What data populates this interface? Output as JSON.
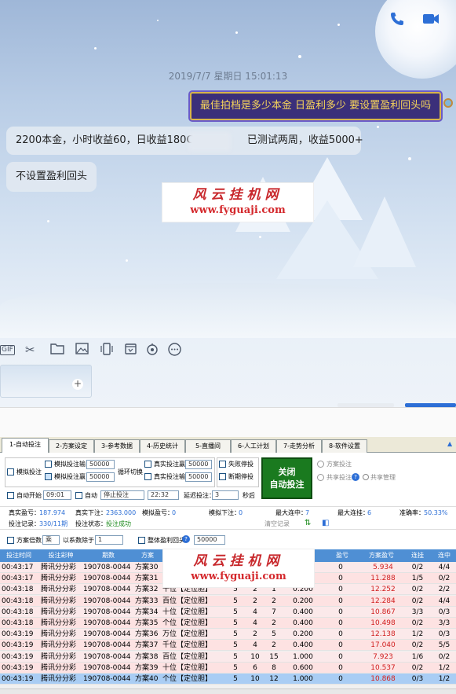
{
  "chat": {
    "timestamp": "2019/7/7 星期日 15:01:13",
    "my_message": "最佳拍档是多少本金 日盈利多少 要设置盈利回头吗",
    "reply1_a": "2200本金，小时收益60，日收益180C",
    "reply1_b": "已测试两周，收益5000+",
    "reply2": "不设置盈利回头",
    "watermark_cn": "风云挂机网",
    "watermark_url": "www.fyguaji.com",
    "toolbar_icons": [
      "gif-icon",
      "scissors-icon",
      "folder-icon",
      "image-icon",
      "shake-icon",
      "calendar-icon",
      "voice-icon",
      "more-icon"
    ],
    "gif_label": "GIF"
  },
  "app": {
    "tabs": [
      "1-自动投注",
      "2-方案设定",
      "3-参考数据",
      "4-历史统计",
      "5-直播间",
      "6-人工计划",
      "7-走势分析",
      "8-软件设置"
    ],
    "controls": {
      "sim_bet": "模拟投注",
      "sim_lose": "模拟投注输",
      "sim_win": "模拟投注赢",
      "real_win": "真实投注赢",
      "real_lose": "真实投注输",
      "val_50000": "50000",
      "loop_switch": "循环切换",
      "stop_fail": "失败停投",
      "stop_break": "断期停投",
      "close_auto": "关闭",
      "close_auto2": "自动投注",
      "plan_bet": "方案投注",
      "share_bet": "共享投注",
      "share_mgr": "共享管理",
      "auto_start": "自动开始",
      "start_time": "09:01",
      "auto": "自动",
      "stop_select": "停止投注",
      "end_time": "22:32",
      "delay": "延迟投注：",
      "delay_val": "3",
      "seconds": "秒后"
    },
    "stats": {
      "real_pl_label": "真实盈亏：",
      "real_pl": "187.974",
      "real_bet_label": "真实下注：",
      "real_bet": "2363.000",
      "sim_pl_label": "模拟盈亏：",
      "sim_pl": "0",
      "sim_bet_label": "模拟下注：",
      "sim_bet": "0",
      "max_win_label": "最大连中：",
      "max_win": "7",
      "max_lose_label": "最大连挂：",
      "max_lose": "6",
      "accuracy_label": "准确率：",
      "accuracy": "50.33%",
      "record_label": "投注记录：",
      "record": "330/11期",
      "status_label": "投注状态：",
      "status": "投注成功",
      "clear_log": "清空记录"
    },
    "options": {
      "plan_mult": "方案倍数",
      "mult_val": "乘",
      "factor": "以系数除于：",
      "factor_val": "1",
      "overall_back": "整体盈利回头",
      "overall_val": "50000"
    },
    "grid": {
      "headers": [
        "投注时间",
        "投注彩种",
        "期数",
        "方案",
        "",
        "",
        "",
        "",
        "盈亏",
        "方案盈亏",
        "连挂",
        "连中"
      ],
      "rows": [
        {
          "time": "00:43:17",
          "game": "腾讯分分彩",
          "issue": "190708-0044",
          "plan": "方案30",
          "pos": "",
          "a": "",
          "b": "",
          "c": "",
          "amt": "",
          "pl": "0",
          "plan_pl": "5.934",
          "lose": "0/2",
          "win": "4/4"
        },
        {
          "time": "00:43:17",
          "game": "腾讯分分彩",
          "issue": "190708-0044",
          "plan": "方案31",
          "pos": "万位【定位胆】",
          "a": "5",
          "b": "",
          "c": "",
          "amt": "0.200",
          "pl": "0",
          "plan_pl": "11.288",
          "lose": "1/5",
          "win": "0/2"
        },
        {
          "time": "00:43:18",
          "game": "腾讯分分彩",
          "issue": "190708-0044",
          "plan": "方案32",
          "pos": "千位【定位胆】",
          "a": "5",
          "b": "2",
          "c": "1",
          "amt": "0.200",
          "pl": "0",
          "plan_pl": "12.252",
          "lose": "0/2",
          "win": "2/2"
        },
        {
          "time": "00:43:18",
          "game": "腾讯分分彩",
          "issue": "190708-0044",
          "plan": "方案33",
          "pos": "百位【定位胆】",
          "a": "5",
          "b": "2",
          "c": "2",
          "amt": "0.200",
          "pl": "0",
          "plan_pl": "12.284",
          "lose": "0/2",
          "win": "4/4"
        },
        {
          "time": "00:43:18",
          "game": "腾讯分分彩",
          "issue": "190708-0044",
          "plan": "方案34",
          "pos": "十位【定位胆】",
          "a": "5",
          "b": "4",
          "c": "7",
          "amt": "0.400",
          "pl": "0",
          "plan_pl": "10.867",
          "lose": "3/3",
          "win": "0/3"
        },
        {
          "time": "00:43:18",
          "game": "腾讯分分彩",
          "issue": "190708-0044",
          "plan": "方案35",
          "pos": "个位【定位胆】",
          "a": "5",
          "b": "4",
          "c": "2",
          "amt": "0.400",
          "pl": "0",
          "plan_pl": "10.498",
          "lose": "0/2",
          "win": "3/3"
        },
        {
          "time": "00:43:19",
          "game": "腾讯分分彩",
          "issue": "190708-0044",
          "plan": "方案36",
          "pos": "万位【定位胆】",
          "a": "5",
          "b": "2",
          "c": "5",
          "amt": "0.200",
          "pl": "0",
          "plan_pl": "12.138",
          "lose": "1/2",
          "win": "0/3"
        },
        {
          "time": "00:43:19",
          "game": "腾讯分分彩",
          "issue": "190708-0044",
          "plan": "方案37",
          "pos": "千位【定位胆】",
          "a": "5",
          "b": "4",
          "c": "2",
          "amt": "0.400",
          "pl": "0",
          "plan_pl": "17.040",
          "lose": "0/2",
          "win": "5/5"
        },
        {
          "time": "00:43:19",
          "game": "腾讯分分彩",
          "issue": "190708-0044",
          "plan": "方案38",
          "pos": "百位【定位胆】",
          "a": "5",
          "b": "10",
          "c": "15",
          "amt": "1.000",
          "pl": "0",
          "plan_pl": "7.923",
          "lose": "1/6",
          "win": "0/2"
        },
        {
          "time": "00:43:19",
          "game": "腾讯分分彩",
          "issue": "190708-0044",
          "plan": "方案39",
          "pos": "十位【定位胆】",
          "a": "5",
          "b": "6",
          "c": "8",
          "amt": "0.600",
          "pl": "0",
          "plan_pl": "10.537",
          "lose": "0/2",
          "win": "1/2"
        },
        {
          "time": "00:43:19",
          "game": "腾讯分分彩",
          "issue": "190708-0044",
          "plan": "方案40",
          "pos": "个位【定位胆】",
          "a": "5",
          "b": "10",
          "c": "12",
          "amt": "1.000",
          "pl": "0",
          "plan_pl": "10.868",
          "lose": "0/3",
          "win": "1/2"
        }
      ]
    }
  },
  "colors": {
    "accent": "#2d6fd6",
    "grid_header": "#4f8fd4",
    "row_pink": "#fde2e2",
    "row_selected": "#a9cdf4",
    "plan_pl_red": "#d12020"
  }
}
